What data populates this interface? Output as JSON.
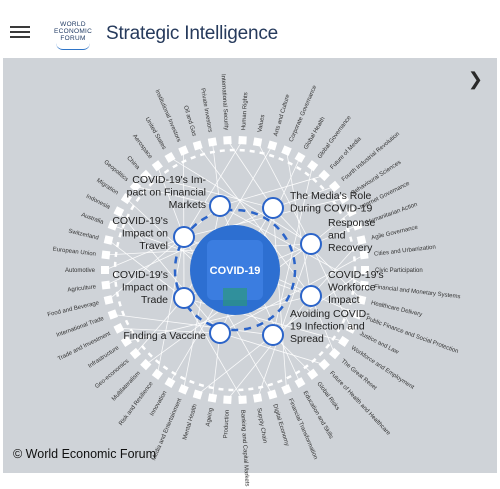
{
  "header": {
    "logo_lines": [
      "WORLD",
      "ECONOMIC",
      "FORUM"
    ],
    "title": "Strategic Intelligence"
  },
  "map": {
    "center": "COVID-19",
    "key_issues": [
      {
        "lines": [
          "COVID-19's Im-",
          "pact on Financial",
          "Markets"
        ]
      },
      {
        "lines": [
          "The Media's Role",
          "During COVID-19"
        ]
      },
      {
        "lines": [
          "COVID-19's",
          "Impact on",
          "Travel"
        ]
      },
      {
        "lines": [
          "Response",
          "and",
          "Recovery"
        ]
      },
      {
        "lines": [
          "COVID-19's",
          "Impact on",
          "Trade"
        ]
      },
      {
        "lines": [
          "COVID-19's",
          "Workforce",
          "Impact"
        ]
      },
      {
        "lines": [
          "Finding a Vaccine"
        ]
      },
      {
        "lines": [
          "Avoiding COVID-",
          "19 Infection and",
          "Spread"
        ]
      }
    ],
    "topics": [
      "Private Investors",
      "International Security",
      "Human Rights",
      "Values",
      "Arts and Culture",
      "Corporate Governance",
      "Global Health",
      "Global Governance",
      "Future of Media",
      "Fourth Industrial Revolution",
      "Behavioural Sciences",
      "Internet Governance",
      "Humanitarian Action",
      "Agile Governance",
      "Cities and Urbanization",
      "Civic Participation",
      "Financial and Monetary Systems",
      "Healthcare Delivery",
      "Public Finance and Social Protection",
      "Justice and Law",
      "Workforce and Employment",
      "The Great Reset",
      "Future of Health and Healthcare",
      "Global Risks",
      "Education and Skills",
      "Financial Transformation",
      "Digital Economy",
      "Supply Chain",
      "Banking and Capital Markets",
      "Production",
      "Ageing",
      "Mental Health",
      "Media and Entertainment",
      "Innovation",
      "Risk and Resilience",
      "Multilateralism",
      "Geo-economics",
      "Infrastructure",
      "Trade and Investment",
      "International Trade",
      "Food and Beverage",
      "Agriculture",
      "Automotive",
      "European Union",
      "Switzerland",
      "Australia",
      "Indonesia",
      "Migration",
      "Geopolitics",
      "China",
      "Aerospace",
      "United States",
      "Institutional Investors",
      "Oil and Gas"
    ]
  },
  "footer": {
    "copyright": "© World Economic Forum"
  },
  "colors": {
    "background": "#cfd3d8",
    "center_blue": "#2d6fd1",
    "ring_dashes": "#2b64c9"
  },
  "icons": {
    "menu": "hamburger-menu-icon",
    "next": "chevron-right-icon"
  }
}
